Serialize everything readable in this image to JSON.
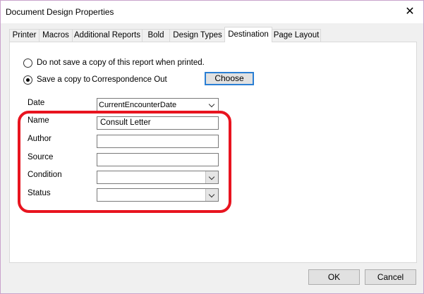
{
  "window": {
    "title": "Document Design Properties",
    "close_symbol": "✕"
  },
  "tabs": [
    {
      "label": "Printer"
    },
    {
      "label": "Macros"
    },
    {
      "label": "Additional Reports"
    },
    {
      "label": "Bold"
    },
    {
      "label": "Design Types"
    },
    {
      "label": "Destination",
      "active": true
    },
    {
      "label": "Page Layout"
    }
  ],
  "destination": {
    "option_no_save": {
      "label": "Do not save a copy of this report when printed.",
      "selected": false
    },
    "option_save": {
      "label": "Save a copy to",
      "selected": true
    },
    "save_location": "Correspondence Out",
    "choose_label": "Choose",
    "date": {
      "label": "Date",
      "value": "CurrentEncounterDate"
    },
    "name": {
      "label": "Name",
      "value": "Consult Letter"
    },
    "author": {
      "label": "Author",
      "value": ""
    },
    "source": {
      "label": "Source",
      "value": ""
    },
    "condition": {
      "label": "Condition",
      "value": ""
    },
    "status": {
      "label": "Status",
      "value": ""
    }
  },
  "buttons": {
    "ok_label": "OK",
    "cancel_label": "Cancel"
  },
  "colors": {
    "highlight": "#e8141f",
    "focus_border": "#2a7fd4"
  }
}
